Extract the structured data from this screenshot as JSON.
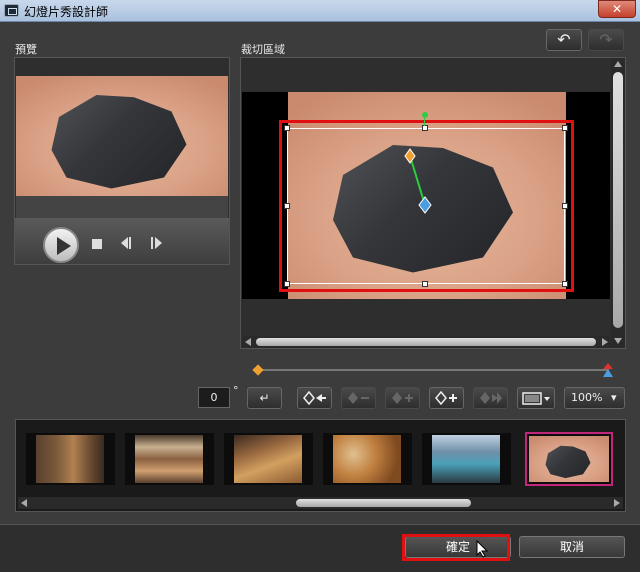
{
  "window": {
    "title": "幻燈片秀設計師",
    "close_glyph": "✕"
  },
  "preview": {
    "label": "預覽"
  },
  "crop": {
    "label": "裁切區域"
  },
  "toolbar": {
    "undo_glyph": "↶",
    "redo_glyph": "↷",
    "angle_value": "0",
    "angle_unit": "°",
    "enter_glyph": "↵",
    "zoom_value": "100%",
    "zoom_arrow": "▾"
  },
  "footer": {
    "ok_label": "確定",
    "cancel_label": "取消"
  },
  "colors": {
    "highlight": "#e01010",
    "selected_border": "#c2267a",
    "rotation_handle": "#2ecc40",
    "keyframe_start": "#f0a030",
    "keyframe_end": "#4a9ee0"
  }
}
